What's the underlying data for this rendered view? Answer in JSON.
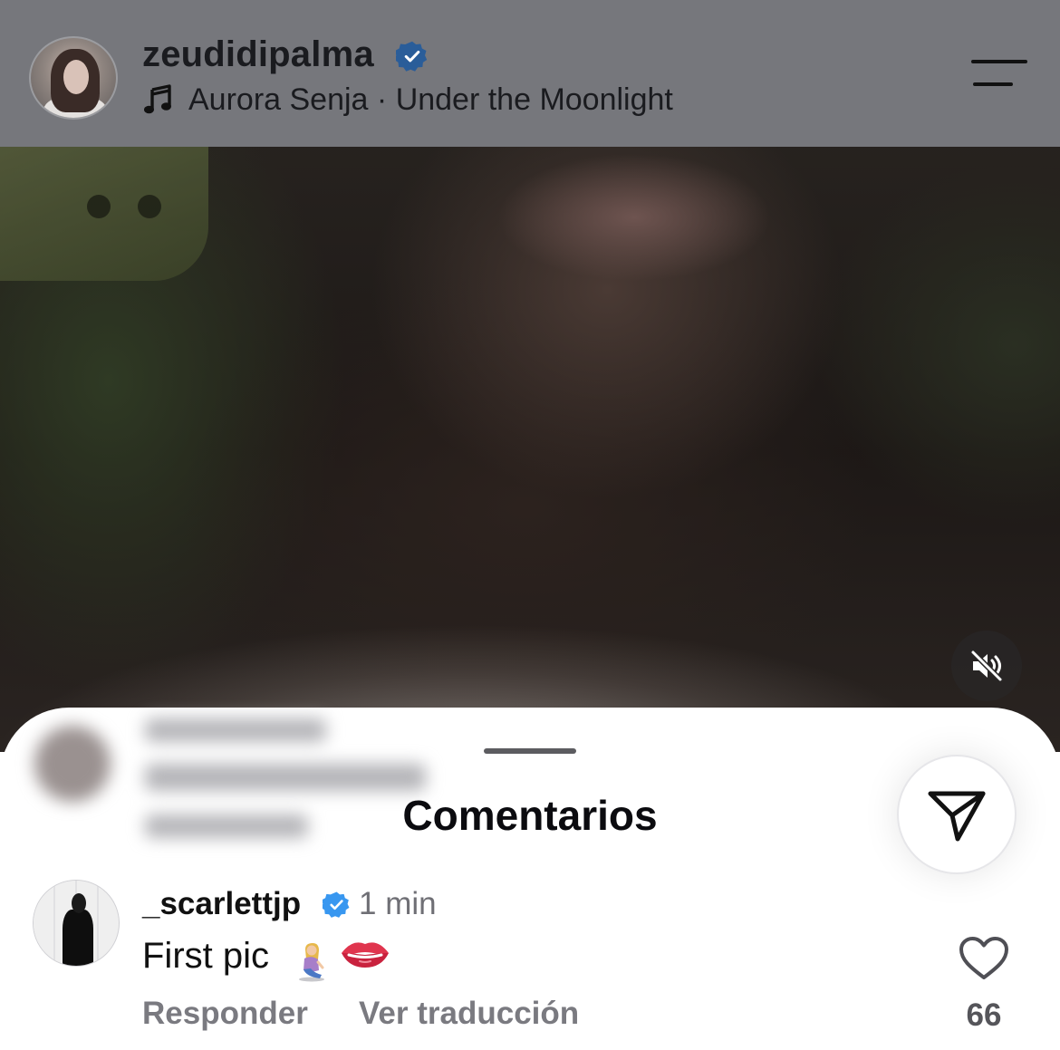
{
  "header": {
    "username": "zeudidipalma",
    "verified": true,
    "music": {
      "artist": "Aurora Senja",
      "separator": " · ",
      "track": "Under the Moonlight"
    }
  },
  "video": {
    "muted": true
  },
  "comments_sheet": {
    "title": "Comentarios",
    "comments": [
      {
        "username": "_scarlettjp",
        "verified": true,
        "time": "1 min",
        "text": "First pic",
        "emojis": [
          "person-kneeling-emoji",
          "lips-emoji"
        ],
        "reply_label": "Responder",
        "translate_label": "Ver traducción",
        "likes": "66"
      }
    ]
  },
  "icons": {
    "music": "music-note-icon",
    "menu": "menu-icon",
    "mute": "speaker-muted-icon",
    "send": "paper-plane-icon",
    "like": "heart-outline-icon",
    "verified": "verified-badge-icon"
  },
  "colors": {
    "verified_blue": "#3897f0",
    "header_overlay": "#76777c",
    "text_primary": "#111111",
    "text_secondary": "#7a7a80"
  }
}
